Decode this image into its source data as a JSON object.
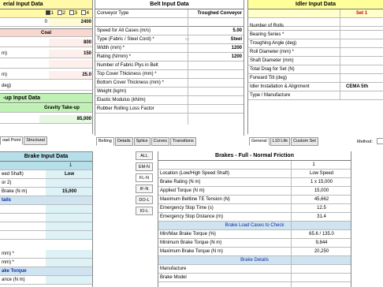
{
  "material": {
    "title": "erial Input Data",
    "radio_labels": [
      "1",
      "2",
      "3",
      "4"
    ],
    "count_value": "0",
    "count_result": "2400",
    "coal_header": "Coal",
    "rows": [
      {
        "label": "",
        "value": "800"
      },
      {
        "label": "m)",
        "value": "150"
      },
      {
        "label": "",
        "value": ""
      },
      {
        "label": "m)",
        "value": "25.0"
      },
      {
        "label": "deg)",
        "value": ""
      }
    ]
  },
  "takeup": {
    "title": "-up Input Data",
    "type": "Gravity Take-up",
    "value": "85,000"
  },
  "left_tabs": [
    "oad Point",
    "Structural"
  ],
  "belt": {
    "title": "Belt Input Data",
    "rows": [
      {
        "label": "Conveyor Type",
        "value": "Troughed Conveyor"
      },
      {
        "label": "",
        "value": ""
      },
      {
        "label": "Speed for All Cases (m/s)",
        "value": "5.00"
      },
      {
        "label": "Type (Fabric / Steel Cord) *",
        "value": "Steel"
      },
      {
        "label": "Width (mm) *",
        "value": "1200"
      },
      {
        "label": "Rating (N/mm) *",
        "value": "1200"
      },
      {
        "label": "Number of Fabric Plys in Belt",
        "value": ""
      },
      {
        "label": "Top Cover Thickness (mm) *",
        "value": ""
      },
      {
        "label": "Bottom Cover Thickness (mm) *",
        "value": ""
      },
      {
        "label": "Weight (kg/m)",
        "value": ""
      },
      {
        "label": "Elastic Modulus (kN/m)",
        "value": ""
      },
      {
        "label": "Rubber Rolling Loss Factor",
        "value": ""
      }
    ],
    "tabs": [
      "Belting",
      "Details",
      "Splice",
      "Curves",
      "Transitions"
    ]
  },
  "idler": {
    "title": "Idler Input Data",
    "set_label": "Set 1",
    "rows": [
      {
        "label": "",
        "value": ""
      },
      {
        "label": "Number of Rolls",
        "value": ""
      },
      {
        "label": "Bearing Series *",
        "value": ""
      },
      {
        "label": "Troughing Angle (deg)",
        "value": ""
      },
      {
        "label": "Roll Diameter (mm) *",
        "value": ""
      },
      {
        "label": "Shaft Diameter (mm)",
        "value": ""
      },
      {
        "label": "Total Drag for Set (N)",
        "value": ""
      },
      {
        "label": "Forward Tilt (deg)",
        "value": ""
      },
      {
        "label": "Idler Installation & Alignment",
        "value": "CEMA 5th"
      },
      {
        "label": "Type / Manufacture",
        "value": ""
      }
    ],
    "tabs": [
      "General",
      "L10 Life",
      "Custom Set"
    ],
    "method_label": "Method:"
  },
  "brake_input": {
    "title": "Brake Input Data",
    "col_header": "1",
    "rows": [
      {
        "label": "eed Shaft)",
        "value": "Low",
        "style": "normal"
      },
      {
        "label": "or 2)",
        "value": "",
        "style": "normal"
      },
      {
        "label": "Brake (N m)",
        "value": "15,000",
        "style": "normal"
      },
      {
        "label": "tails",
        "value": "",
        "style": "blue"
      },
      {
        "label": "",
        "value": "",
        "style": "normal"
      },
      {
        "label": "",
        "value": "",
        "style": "normal"
      },
      {
        "label": "",
        "value": "",
        "style": "normal"
      },
      {
        "label": "",
        "value": "",
        "style": "normal"
      },
      {
        "label": "mm) *",
        "value": "",
        "style": "normal"
      },
      {
        "label": "mm) *",
        "value": "",
        "style": "normal"
      },
      {
        "label": "ake Torque",
        "value": "",
        "style": "blue"
      },
      {
        "label": "ance (N m)",
        "value": "",
        "style": "normal"
      }
    ]
  },
  "side_tabs": [
    "ALL",
    "EM-N",
    "FL-N",
    "IF-N",
    "DO-L",
    "IO-L"
  ],
  "brakes_result": {
    "title": "Brakes - Full - Normal Friction",
    "col_header": "1",
    "rows": [
      {
        "label": "Location (Low/High Speed Shaft)",
        "value": "Low Speed",
        "kind": "row"
      },
      {
        "label": "Brake Rating (N m)",
        "value": "1 x 15,000",
        "kind": "row"
      },
      {
        "label": "Applied Torque (N m)",
        "value": "15,000",
        "kind": "row"
      },
      {
        "label": "Maximum Beltline TE Tension (N)",
        "value": "45,662",
        "kind": "row"
      },
      {
        "label": "Emergency Stop Time (s)",
        "value": "12.5",
        "kind": "row"
      },
      {
        "label": "Emergency Stop Distance (m)",
        "value": "31.4",
        "kind": "row"
      },
      {
        "label": "Brake Load Cases to Check",
        "value": "",
        "kind": "section"
      },
      {
        "label": "Min/Max Brake Torque (%)",
        "value": "65.6 / 135.0",
        "kind": "row"
      },
      {
        "label": "Minimum Brake Torque (N m)",
        "value": "9,844",
        "kind": "row"
      },
      {
        "label": "Maximum Brake Torque (N m)",
        "value": "20,250",
        "kind": "row"
      },
      {
        "label": "Brake Details",
        "value": "",
        "kind": "section"
      },
      {
        "label": "Manufacture",
        "value": "",
        "kind": "row"
      },
      {
        "label": "Brake Model",
        "value": "",
        "kind": "row"
      }
    ]
  },
  "colors": {
    "material_header": "#fff9a8",
    "coal_header": "#f8d7cf",
    "takeup_header": "#bff0b4",
    "idler_header": "#ffff99",
    "brake_header": "#b7dfe9",
    "brake_body": "#ddf2f6",
    "section": "#cfe3f0"
  }
}
